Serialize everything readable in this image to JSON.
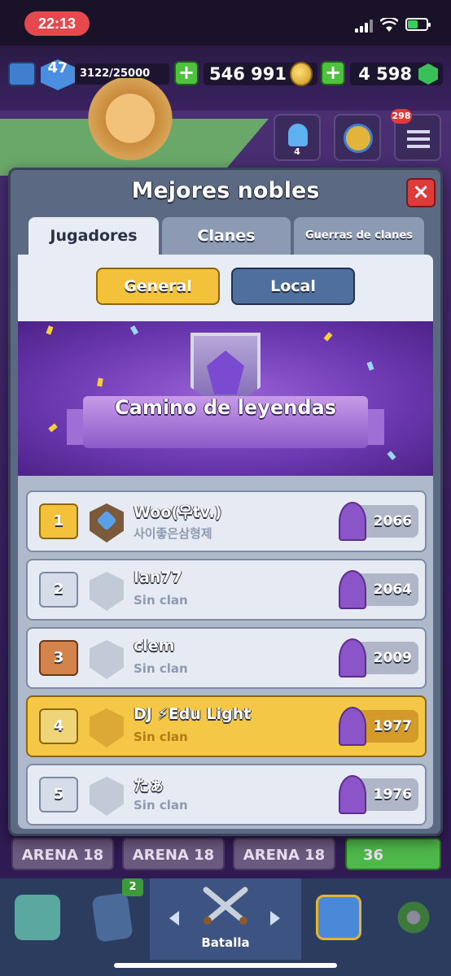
{
  "status_bar": {
    "time": "22:13"
  },
  "resources": {
    "level": "47",
    "xp": "3122/25000",
    "gold": "546 991",
    "gems": "4 598"
  },
  "header_buttons": {
    "friends_count": "4",
    "notifications_count": "298"
  },
  "modal": {
    "title": "Mejores nobles",
    "close_label": "×",
    "tabs": [
      {
        "label": "Jugadores",
        "active": true
      },
      {
        "label": "Clanes",
        "active": false
      },
      {
        "label": "Guerras de clanes",
        "active": false
      }
    ],
    "filters": {
      "general": "General",
      "local": "Local"
    },
    "banner_title": "Camino de leyendas",
    "rows": [
      {
        "rank": "1",
        "name": "Woo(우tv.)",
        "clan": "사이좋은삼형제",
        "trophies": "2066"
      },
      {
        "rank": "2",
        "name": "Ian77",
        "clan": "Sin clan",
        "trophies": "2064"
      },
      {
        "rank": "3",
        "name": "clem",
        "clan": "Sin clan",
        "trophies": "2009"
      },
      {
        "rank": "4",
        "name": "DJ ⚡Edu Light",
        "clan": "Sin clan",
        "trophies": "1977"
      },
      {
        "rank": "5",
        "name": "たぁ",
        "clan": "Sin clan",
        "trophies": "1976"
      }
    ]
  },
  "background": {
    "arenas": [
      "ARENA 18",
      "ARENA 18",
      "ARENA 18"
    ],
    "count_badge": "36"
  },
  "bottom_nav": {
    "cards_badge": "2",
    "battle_label": "Batalla"
  },
  "colors": {
    "accent_gold": "#f3c23a",
    "close_red": "#e03b3b",
    "modal_bg": "#5b6a82",
    "banner_purple": "#6b38b0"
  }
}
